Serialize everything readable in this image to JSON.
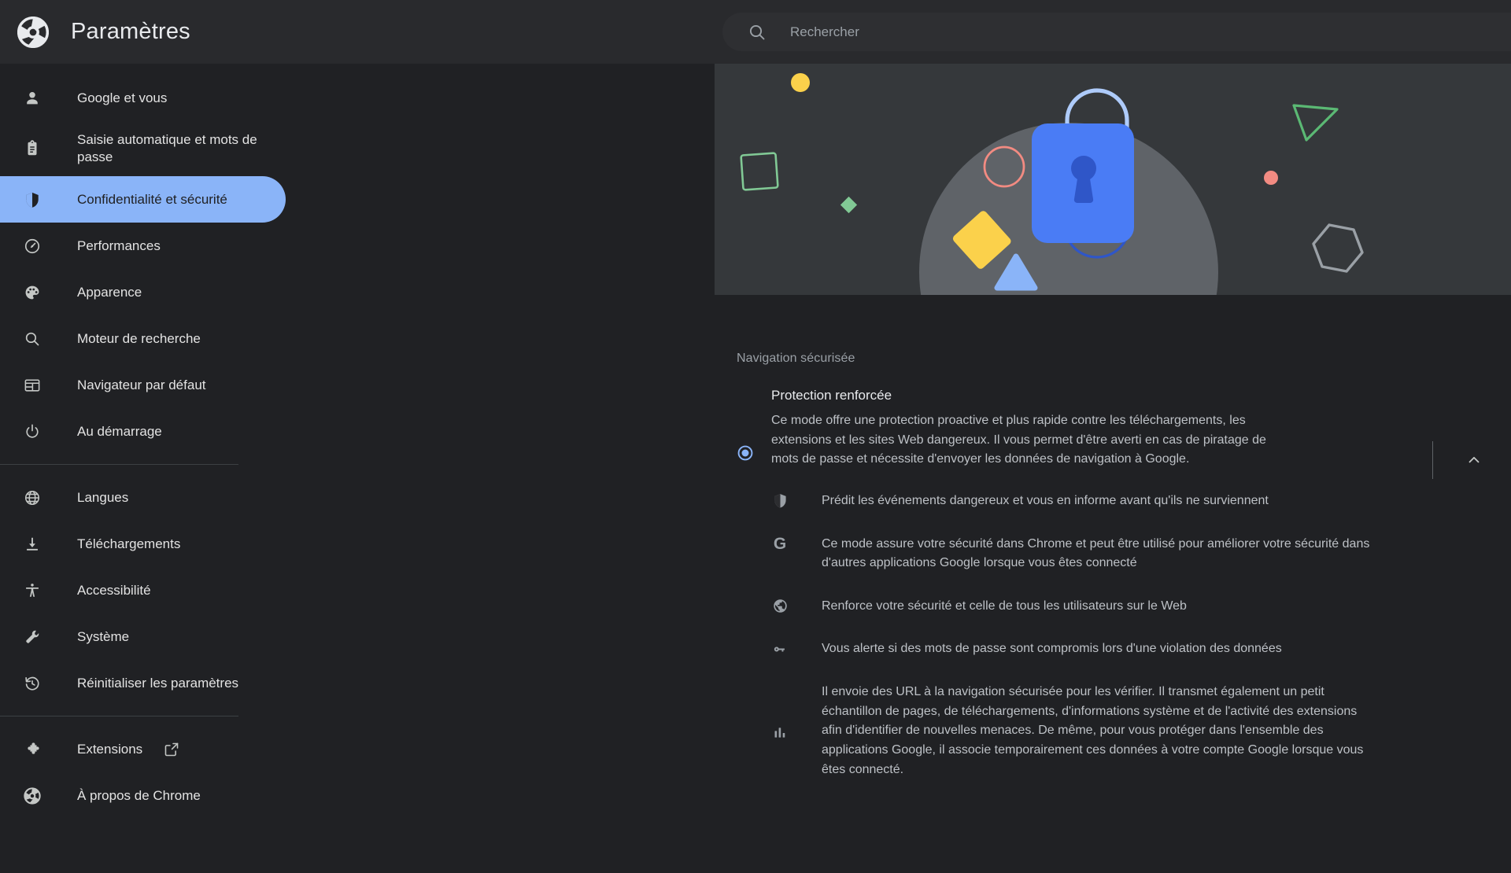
{
  "header": {
    "logo_icon": "chrome-logo-icon",
    "title": "Paramètres",
    "search": {
      "icon": "search-icon",
      "placeholder": "Rechercher",
      "value": ""
    }
  },
  "sidebar": {
    "groups": [
      {
        "items": [
          {
            "icon": "person-icon",
            "label": "Google et vous",
            "selected": false,
            "tall": false
          },
          {
            "icon": "clipboard-icon",
            "label": "Saisie automatique et mots de passe",
            "selected": false,
            "tall": true
          },
          {
            "icon": "shield-icon",
            "label": "Confidentialité et sécurité",
            "selected": true,
            "tall": false
          },
          {
            "icon": "speedometer-icon",
            "label": "Performances",
            "selected": false,
            "tall": false
          },
          {
            "icon": "palette-icon",
            "label": "Apparence",
            "selected": false,
            "tall": false
          },
          {
            "icon": "search-icon",
            "label": "Moteur de recherche",
            "selected": false,
            "tall": false
          },
          {
            "icon": "browser-window-icon",
            "label": "Navigateur par défaut",
            "selected": false,
            "tall": false
          },
          {
            "icon": "power-icon",
            "label": "Au démarrage",
            "selected": false,
            "tall": false
          }
        ]
      },
      {
        "items": [
          {
            "icon": "globe-icon",
            "label": "Langues",
            "selected": false,
            "tall": false
          },
          {
            "icon": "download-icon",
            "label": "Téléchargements",
            "selected": false,
            "tall": false
          },
          {
            "icon": "accessibility-icon",
            "label": "Accessibilité",
            "selected": false,
            "tall": false
          },
          {
            "icon": "wrench-icon",
            "label": "Système",
            "selected": false,
            "tall": false
          },
          {
            "icon": "restore-clock-icon",
            "label": "Réinitialiser les paramètres",
            "selected": false,
            "tall": false
          }
        ]
      },
      {
        "items": [
          {
            "icon": "puzzle-icon",
            "label": "Extensions",
            "selected": false,
            "tall": false,
            "external_icon": "external-link-icon"
          },
          {
            "icon": "chrome-logo-icon",
            "label": "À propos de Chrome",
            "selected": false,
            "tall": false
          }
        ]
      }
    ]
  },
  "main": {
    "hero": {
      "alt": "safe-browsing-lock-illustration",
      "colors": {
        "background": "#35383b",
        "circle": "#5f6368",
        "lock_body": "#4a7cf5",
        "lock_shackle": "#aecbfa",
        "keyhole": "#2f56c8",
        "yellow": "#fbd14b",
        "red_outline": "#f28b82",
        "green_outline": "#81c995",
        "blue_triangle": "#8ab4f8",
        "gray_outline": "#9aa0a6"
      }
    },
    "section_label": "Navigation sécurisée",
    "option": {
      "selected": true,
      "radio_icon": "radio-button-selected-icon",
      "title": "Protection renforcée",
      "description": "Ce mode offre une protection proactive et plus rapide contre les téléchargements, les extensions et les sites Web dangereux. Il vous permet d'être averti en cas de piratage de mots de passe et nécessite d'envoyer les données de navigation à Google.",
      "collapse_icon": "chevron-up-icon"
    },
    "features": [
      {
        "icon": "shield-icon",
        "text": "Prédit les événements dangereux et vous en informe avant qu'ils ne surviennent"
      },
      {
        "icon": "google-g-icon",
        "text": "Ce mode assure votre sécurité dans Chrome et peut être utilisé pour améliorer votre sécurité dans d'autres applications Google lorsque vous êtes connecté"
      },
      {
        "icon": "globe-icon",
        "text": "Renforce votre sécurité et celle de tous les utilisateurs sur le Web"
      },
      {
        "icon": "key-icon",
        "text": "Vous alerte si des mots de passe sont compromis lors d'une violation des données"
      },
      {
        "icon": "bar-chart-icon",
        "text": "Il envoie des URL à la navigation sécurisée pour les vérifier. Il transmet également un petit échantillon de pages, de téléchargements, d'informations système et de l'activité des extensions afin d'identifier de nouvelles menaces. De même, pour vous protéger dans l'ensemble des applications Google, il associe temporairement ces données à votre compte Google lorsque vous êtes connecté."
      }
    ]
  },
  "theme": {
    "background": "#202124",
    "header_background": "#292a2d",
    "accent": "#8ab4f8",
    "text_primary": "#e8eaed",
    "text_secondary": "#bdc1c6",
    "text_muted": "#9aa0a6",
    "divider": "#3c4043"
  }
}
